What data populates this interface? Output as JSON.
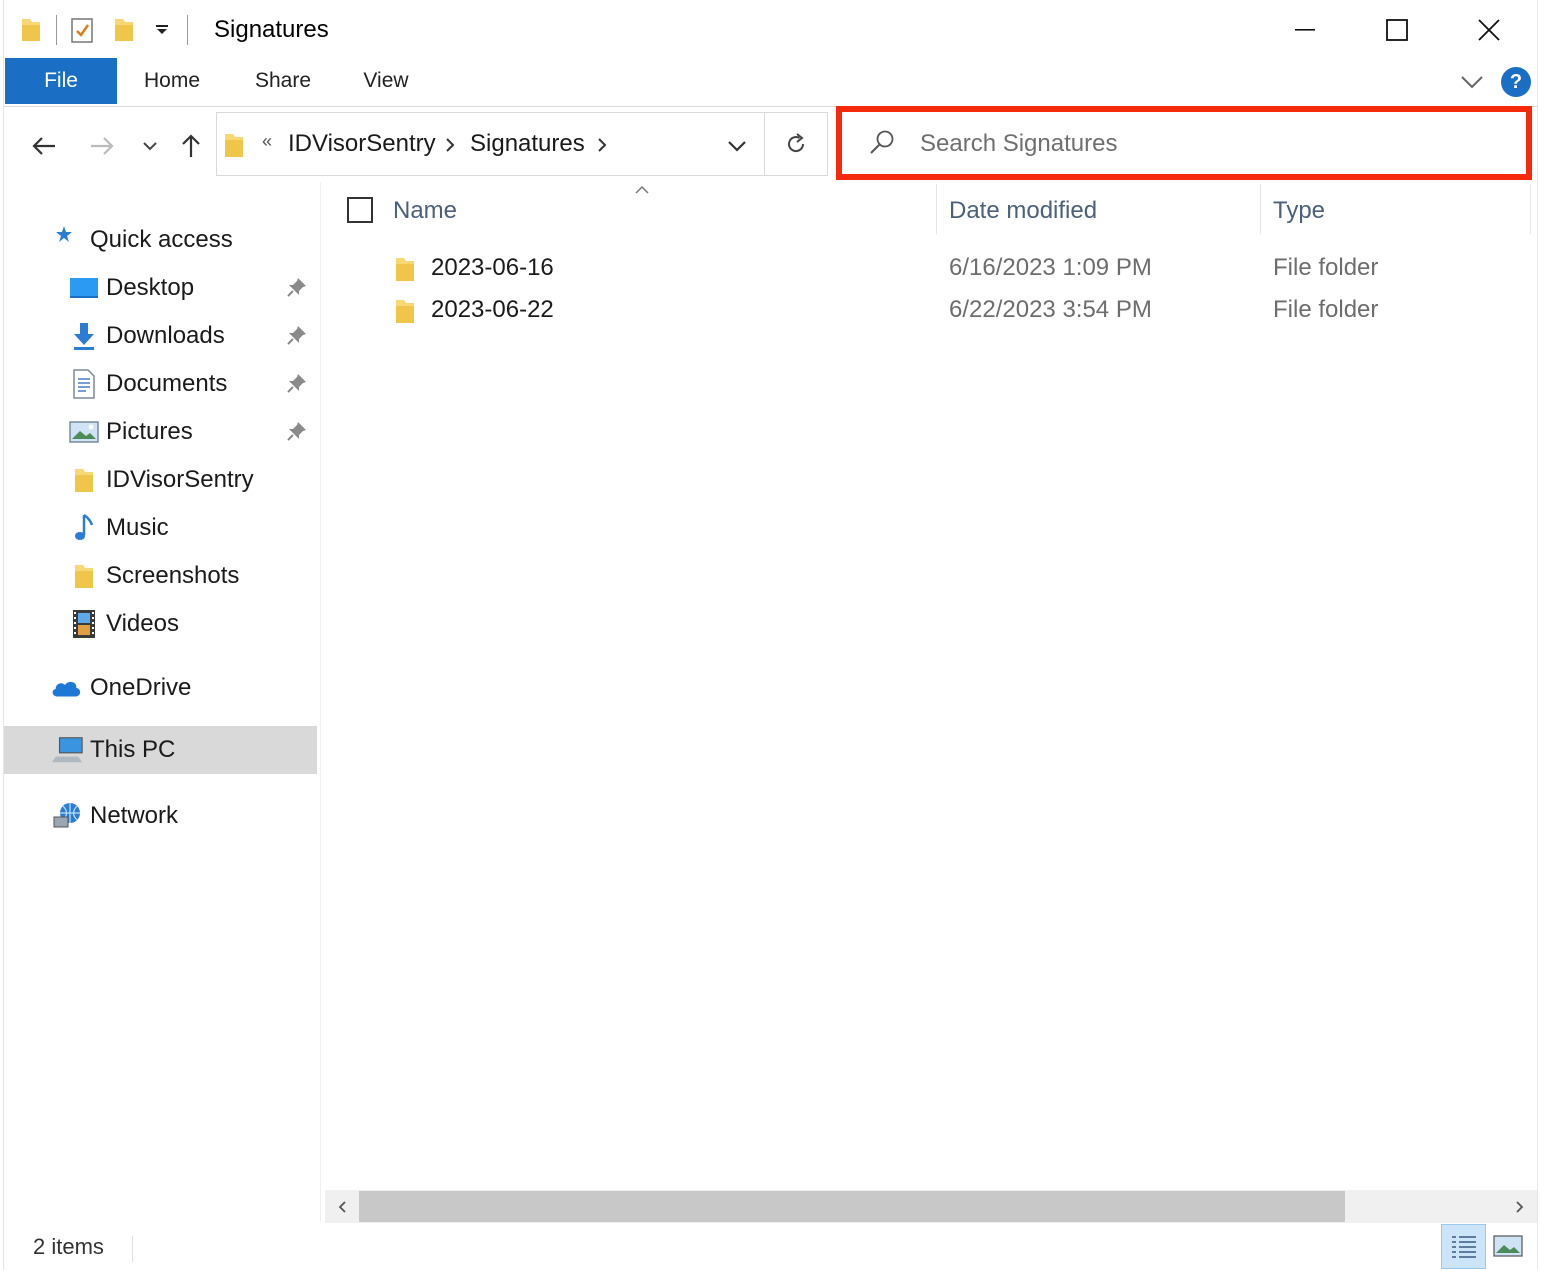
{
  "window": {
    "title": "Signatures"
  },
  "ribbon": {
    "tabs": [
      "File",
      "Home",
      "Share",
      "View"
    ],
    "help_label": "?"
  },
  "address_bar": {
    "overflow_marker": "«",
    "crumbs": [
      "IDVisorSentry",
      "Signatures"
    ]
  },
  "search": {
    "placeholder": "Search Signatures",
    "highlight_color": "#f52a0d"
  },
  "navigation_pane": {
    "quick_access": "Quick access",
    "pinned": [
      "Desktop",
      "Downloads",
      "Documents",
      "Pictures"
    ],
    "recent": [
      "IDVisorSentry",
      "Music",
      "Screenshots",
      "Videos"
    ],
    "onedrive": "OneDrive",
    "this_pc": "This PC",
    "network": "Network",
    "selected": "This PC"
  },
  "file_list": {
    "columns": [
      "Name",
      "Date modified",
      "Type"
    ],
    "rows": [
      {
        "name": "2023-06-16",
        "date_modified": "6/16/2023 1:09 PM",
        "type": "File folder"
      },
      {
        "name": "2023-06-22",
        "date_modified": "6/22/2023 3:54 PM",
        "type": "File folder"
      }
    ]
  },
  "status_bar": {
    "item_count": "2 items"
  },
  "colors": {
    "accent": "#1a6fc4",
    "folder": "#f8d775",
    "selection": "#d9d9d9"
  }
}
